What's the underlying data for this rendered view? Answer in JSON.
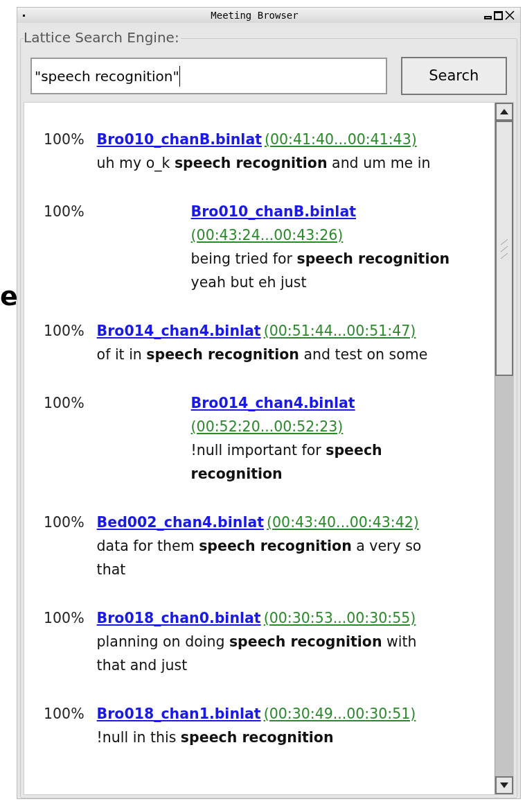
{
  "background_fragment": "e",
  "window": {
    "title": "Meeting Browser"
  },
  "group": {
    "label": "Lattice Search Engine:"
  },
  "search": {
    "value": "\"speech recognition\"",
    "button": "Search"
  },
  "results": [
    {
      "kind": "inline",
      "score": "100%",
      "file": "Bro010_chanB.binlat",
      "time": "(00:41:40...00:41:43)",
      "text": "uh my o_k **speech recognition** and um me in"
    },
    {
      "kind": "stacked",
      "score": "100%",
      "file": "Bro010_chanB.binlat",
      "time": "(00:43:24...00:43:26)",
      "text": "being tried for **speech recognition** yeah but eh just"
    },
    {
      "kind": "inline",
      "score": "100%",
      "file": "Bro014_chan4.binlat",
      "time": "(00:51:44...00:51:47)",
      "text": "of it in **speech recognition** and test on some"
    },
    {
      "kind": "stacked",
      "score": "100%",
      "file": "Bro014_chan4.binlat",
      "time": "(00:52:20...00:52:23)",
      "text": "!null important for **speech recognition**"
    },
    {
      "kind": "inline",
      "score": "100%",
      "file": "Bed002_chan4.binlat",
      "time": "(00:43:40...00:43:42)",
      "text": "data for them **speech recognition** a very so that"
    },
    {
      "kind": "inline",
      "score": "100%",
      "file": "Bro018_chan0.binlat",
      "time": "(00:30:53...00:30:55)",
      "text": "planning on doing **speech recognition** with that and just"
    },
    {
      "kind": "inline",
      "score": "100%",
      "file": "Bro018_chan1.binlat",
      "time": "(00:30:49...00:30:51)",
      "text": "!null in this **speech recognition**"
    }
  ]
}
